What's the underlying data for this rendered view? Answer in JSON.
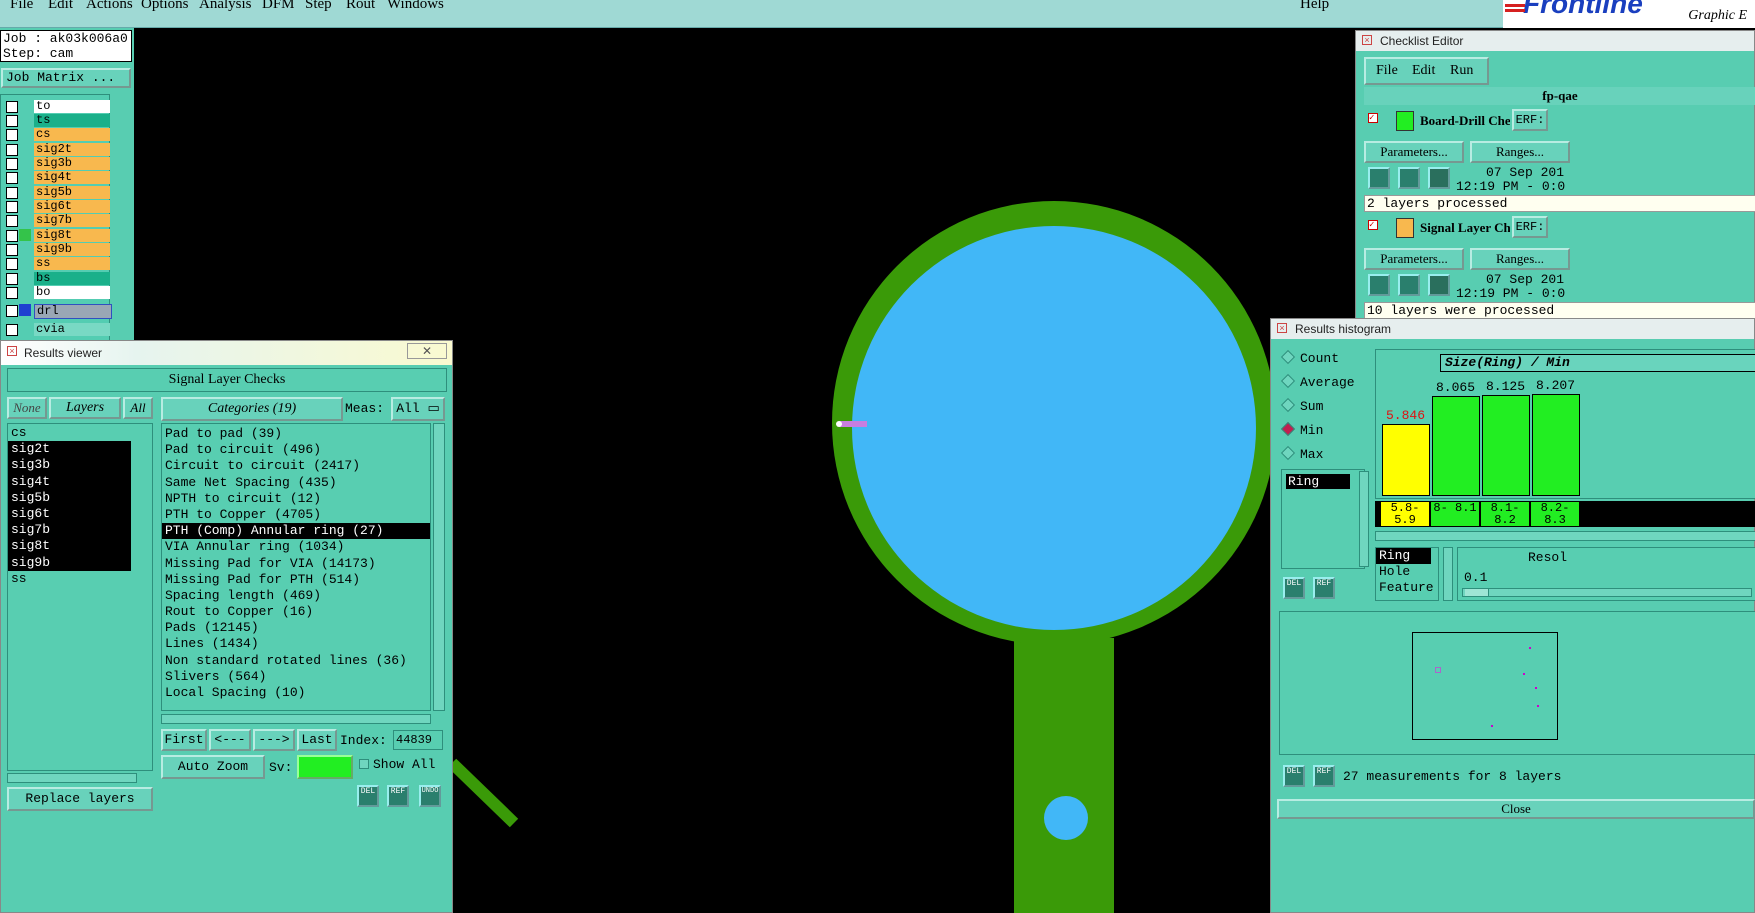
{
  "menu": {
    "items": [
      "File",
      "Edit",
      "Actions",
      "Options",
      "Analysis",
      "DFM",
      "Step",
      "Rout",
      "Windows"
    ],
    "help": "Help"
  },
  "logo": {
    "brand": "Frontline",
    "sub": "Graphic E"
  },
  "job": {
    "job_label": "Job : ak03k006a0",
    "step_label": "Step: cam",
    "matrix_button": "Job Matrix ..."
  },
  "layers": [
    {
      "name": "to",
      "color": "#ffffff"
    },
    {
      "name": "ts",
      "color": "#1ab08a"
    },
    {
      "name": "cs",
      "color": "#f8b84e"
    },
    {
      "name": "sig2t",
      "color": "#f8b84e"
    },
    {
      "name": "sig3b",
      "color": "#f8b84e"
    },
    {
      "name": "sig4t",
      "color": "#f8b84e"
    },
    {
      "name": "sig5b",
      "color": "#f8b84e"
    },
    {
      "name": "sig6t",
      "color": "#f8b84e"
    },
    {
      "name": "sig7b",
      "color": "#f8b84e"
    },
    {
      "name": "sig8t",
      "color": "#f8b84e"
    },
    {
      "name": "sig9b",
      "color": "#f8b84e"
    },
    {
      "name": "ss",
      "color": "#f8b84e"
    },
    {
      "name": "bs",
      "color": "#1ab08a"
    },
    {
      "name": "bo",
      "color": "#ffffff"
    },
    {
      "name": "drl",
      "color": "#9aa7b5"
    },
    {
      "name": "cvia",
      "color": "#79d9c4"
    }
  ],
  "results_viewer": {
    "title": "Results viewer",
    "header": "Signal Layer Checks",
    "none_btn": "None",
    "layers_btn": "Layers",
    "all_btn": "All",
    "categories_btn": "Categories (19)",
    "meas_label": "Meas:",
    "meas_value": "All",
    "layer_list": [
      "cs",
      "sig2t",
      "sig3b",
      "sig4t",
      "sig5b",
      "sig6t",
      "sig7b",
      "sig8t",
      "sig9b",
      "ss"
    ],
    "categories": [
      "Pad to pad (39)",
      "Pad to circuit (496)",
      "Circuit to circuit (2417)",
      "Same Net Spacing (435)",
      "NPTH to circuit (12)",
      "PTH to Copper (4705)",
      "PTH (Comp) Annular ring (27)",
      "VIA Annular ring (1034)",
      "Missing Pad for VIA (14173)",
      "Missing Pad for PTH (514)",
      "Spacing length (469)",
      "Rout to Copper (16)",
      "Pads (12145)",
      "Lines (1434)",
      "Non standard rotated lines (36)",
      "Slivers (564)",
      "Local Spacing (10)"
    ],
    "first_btn": "First",
    "prev_btn": "<---",
    "next_btn": "--->",
    "last_btn": "Last",
    "index_label": "Index:",
    "index_value": "44839",
    "zoom_btn": "Auto Zoom",
    "sv_label": "Sv:",
    "show_all": "Show All",
    "replace_btn": "Replace layers",
    "del": "DEL",
    "ref": "REF",
    "undo": "UNDO"
  },
  "checklist": {
    "title": "Checklist Editor",
    "menu": [
      "File",
      "Edit",
      "Run"
    ],
    "name": "fp-qae",
    "items": [
      {
        "label": "Board-Drill Che",
        "erf": "ERF:",
        "params": "Parameters...",
        "ranges": "Ranges...",
        "date": "07 Sep 201",
        "time": "12:19 PM - 0:0",
        "status": "2 layers processed"
      },
      {
        "label": "Signal Layer Ch",
        "erf": "ERF:",
        "params": "Parameters...",
        "ranges": "Ranges...",
        "date": "07 Sep 201",
        "time": "12:19 PM - 0:0",
        "status": "10 layers were processed"
      }
    ]
  },
  "histogram": {
    "title": "Results histogram",
    "options": [
      "Count",
      "Average",
      "Sum",
      "Min",
      "Max"
    ],
    "selected_option": "Min",
    "list_item": "Ring",
    "heading": "Size(Ring) / Min",
    "bars": [
      {
        "value": "5.846",
        "range": "5.8- 5.9",
        "fill": 0.6
      },
      {
        "value": "8.065",
        "range": "8- 8.1",
        "fill": 0.83
      },
      {
        "value": "8.125",
        "range": "8.1- 8.2",
        "fill": 0.84
      },
      {
        "value": "8.207",
        "range": "8.2- 8.3",
        "fill": 0.85
      }
    ],
    "types": [
      "Ring",
      "Hole",
      "Feature"
    ],
    "resolution_label": "Resol",
    "resolution_value": "0.1",
    "summary": "27 measurements for 8 layers",
    "close": "Close"
  }
}
